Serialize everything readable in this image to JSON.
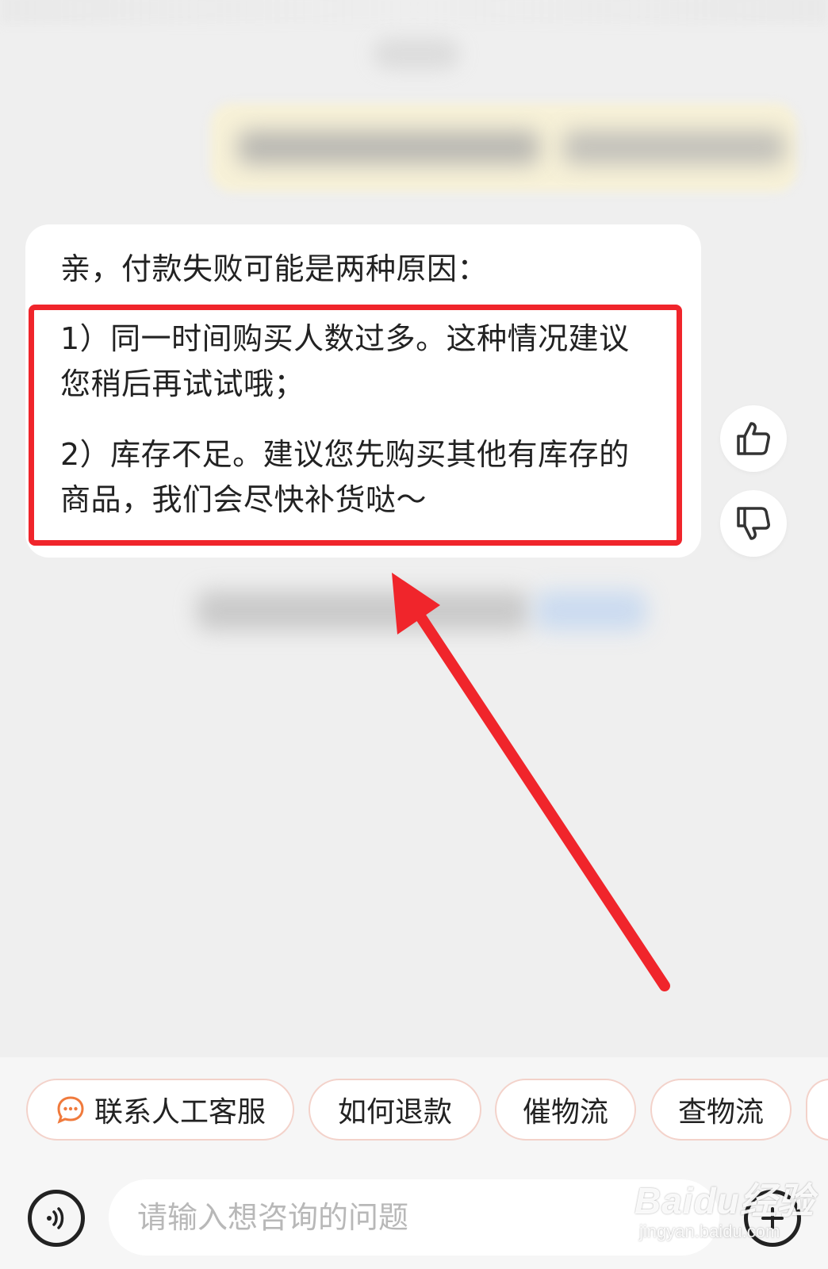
{
  "bot_message": {
    "intro": "亲，付款失败可能是两种原因：",
    "reason1_line1": "1）同一时间购买人数过多。这种情况建议",
    "reason1_line2": "您稍后再试试哦；",
    "reason2_line1": "2）库存不足。建议您先购买其他有库存的",
    "reason2_line2": "商品，我们会尽快补货哒～"
  },
  "feedback": {
    "like_icon": "thumbs-up-icon",
    "dislike_icon": "thumbs-down-icon"
  },
  "quick_actions": [
    {
      "label": "联系人工客服",
      "icon": "chat-bubble-icon"
    },
    {
      "label": "如何退款"
    },
    {
      "label": "催物流"
    },
    {
      "label": "查物流"
    }
  ],
  "input": {
    "placeholder": "请输入想咨询的问题",
    "voice_icon": "voice-wave-icon",
    "plus_icon": "plus-icon"
  },
  "watermark": {
    "brand": "Baidu经验",
    "url": "jingyan.baidu.com"
  },
  "colors": {
    "annotation_red": "#f0252b",
    "chip_border": "#f3d2ca",
    "chat_icon_orange": "#f07a3c",
    "background": "#efefef"
  }
}
